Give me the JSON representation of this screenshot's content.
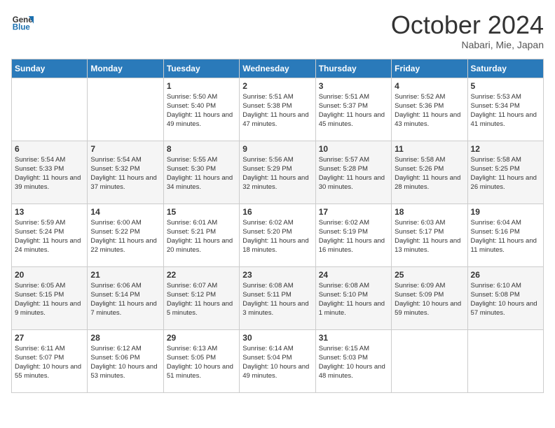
{
  "header": {
    "logo_line1": "General",
    "logo_line2": "Blue",
    "month": "October 2024",
    "location": "Nabari, Mie, Japan"
  },
  "weekdays": [
    "Sunday",
    "Monday",
    "Tuesday",
    "Wednesday",
    "Thursday",
    "Friday",
    "Saturday"
  ],
  "weeks": [
    [
      {
        "day": "",
        "empty": true
      },
      {
        "day": "",
        "empty": true
      },
      {
        "day": "1",
        "sunrise": "5:50 AM",
        "sunset": "5:40 PM",
        "daylight": "11 hours and 49 minutes."
      },
      {
        "day": "2",
        "sunrise": "5:51 AM",
        "sunset": "5:38 PM",
        "daylight": "11 hours and 47 minutes."
      },
      {
        "day": "3",
        "sunrise": "5:51 AM",
        "sunset": "5:37 PM",
        "daylight": "11 hours and 45 minutes."
      },
      {
        "day": "4",
        "sunrise": "5:52 AM",
        "sunset": "5:36 PM",
        "daylight": "11 hours and 43 minutes."
      },
      {
        "day": "5",
        "sunrise": "5:53 AM",
        "sunset": "5:34 PM",
        "daylight": "11 hours and 41 minutes."
      }
    ],
    [
      {
        "day": "6",
        "sunrise": "5:54 AM",
        "sunset": "5:33 PM",
        "daylight": "11 hours and 39 minutes."
      },
      {
        "day": "7",
        "sunrise": "5:54 AM",
        "sunset": "5:32 PM",
        "daylight": "11 hours and 37 minutes."
      },
      {
        "day": "8",
        "sunrise": "5:55 AM",
        "sunset": "5:30 PM",
        "daylight": "11 hours and 34 minutes."
      },
      {
        "day": "9",
        "sunrise": "5:56 AM",
        "sunset": "5:29 PM",
        "daylight": "11 hours and 32 minutes."
      },
      {
        "day": "10",
        "sunrise": "5:57 AM",
        "sunset": "5:28 PM",
        "daylight": "11 hours and 30 minutes."
      },
      {
        "day": "11",
        "sunrise": "5:58 AM",
        "sunset": "5:26 PM",
        "daylight": "11 hours and 28 minutes."
      },
      {
        "day": "12",
        "sunrise": "5:58 AM",
        "sunset": "5:25 PM",
        "daylight": "11 hours and 26 minutes."
      }
    ],
    [
      {
        "day": "13",
        "sunrise": "5:59 AM",
        "sunset": "5:24 PM",
        "daylight": "11 hours and 24 minutes."
      },
      {
        "day": "14",
        "sunrise": "6:00 AM",
        "sunset": "5:22 PM",
        "daylight": "11 hours and 22 minutes."
      },
      {
        "day": "15",
        "sunrise": "6:01 AM",
        "sunset": "5:21 PM",
        "daylight": "11 hours and 20 minutes."
      },
      {
        "day": "16",
        "sunrise": "6:02 AM",
        "sunset": "5:20 PM",
        "daylight": "11 hours and 18 minutes."
      },
      {
        "day": "17",
        "sunrise": "6:02 AM",
        "sunset": "5:19 PM",
        "daylight": "11 hours and 16 minutes."
      },
      {
        "day": "18",
        "sunrise": "6:03 AM",
        "sunset": "5:17 PM",
        "daylight": "11 hours and 13 minutes."
      },
      {
        "day": "19",
        "sunrise": "6:04 AM",
        "sunset": "5:16 PM",
        "daylight": "11 hours and 11 minutes."
      }
    ],
    [
      {
        "day": "20",
        "sunrise": "6:05 AM",
        "sunset": "5:15 PM",
        "daylight": "11 hours and 9 minutes."
      },
      {
        "day": "21",
        "sunrise": "6:06 AM",
        "sunset": "5:14 PM",
        "daylight": "11 hours and 7 minutes."
      },
      {
        "day": "22",
        "sunrise": "6:07 AM",
        "sunset": "5:12 PM",
        "daylight": "11 hours and 5 minutes."
      },
      {
        "day": "23",
        "sunrise": "6:08 AM",
        "sunset": "5:11 PM",
        "daylight": "11 hours and 3 minutes."
      },
      {
        "day": "24",
        "sunrise": "6:08 AM",
        "sunset": "5:10 PM",
        "daylight": "11 hours and 1 minute."
      },
      {
        "day": "25",
        "sunrise": "6:09 AM",
        "sunset": "5:09 PM",
        "daylight": "10 hours and 59 minutes."
      },
      {
        "day": "26",
        "sunrise": "6:10 AM",
        "sunset": "5:08 PM",
        "daylight": "10 hours and 57 minutes."
      }
    ],
    [
      {
        "day": "27",
        "sunrise": "6:11 AM",
        "sunset": "5:07 PM",
        "daylight": "10 hours and 55 minutes."
      },
      {
        "day": "28",
        "sunrise": "6:12 AM",
        "sunset": "5:06 PM",
        "daylight": "10 hours and 53 minutes."
      },
      {
        "day": "29",
        "sunrise": "6:13 AM",
        "sunset": "5:05 PM",
        "daylight": "10 hours and 51 minutes."
      },
      {
        "day": "30",
        "sunrise": "6:14 AM",
        "sunset": "5:04 PM",
        "daylight": "10 hours and 49 minutes."
      },
      {
        "day": "31",
        "sunrise": "6:15 AM",
        "sunset": "5:03 PM",
        "daylight": "10 hours and 48 minutes."
      },
      {
        "day": "",
        "empty": true
      },
      {
        "day": "",
        "empty": true
      }
    ]
  ]
}
